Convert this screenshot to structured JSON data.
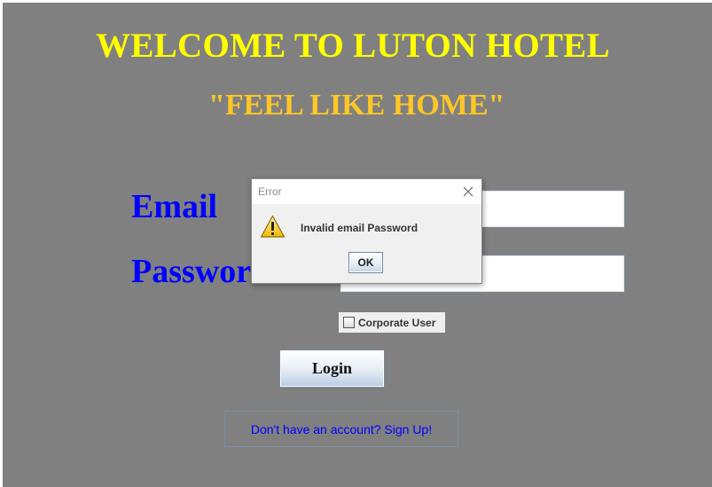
{
  "app": {
    "title": "WELCOME TO LUTON HOTEL",
    "slogan": "\"FEEL LIKE HOME\""
  },
  "form": {
    "email_label": "Email",
    "password_label": "Password",
    "email_value": "",
    "password_value": "",
    "corporate_user_label": "Corporate User",
    "corporate_user_checked": false,
    "login_label": "Login",
    "signup_link_label": "Don't have an account? Sign Up!"
  },
  "dialog": {
    "title": "Error",
    "message": "Invalid email Password",
    "ok_label": "OK",
    "icon": "warning-icon",
    "close_icon": "close-icon"
  },
  "colors": {
    "background": "#808080",
    "title": "#ffff00",
    "slogan": "#ffc726",
    "labels": "#0000ff",
    "link": "#0000ff",
    "warning": "#f5c518"
  }
}
